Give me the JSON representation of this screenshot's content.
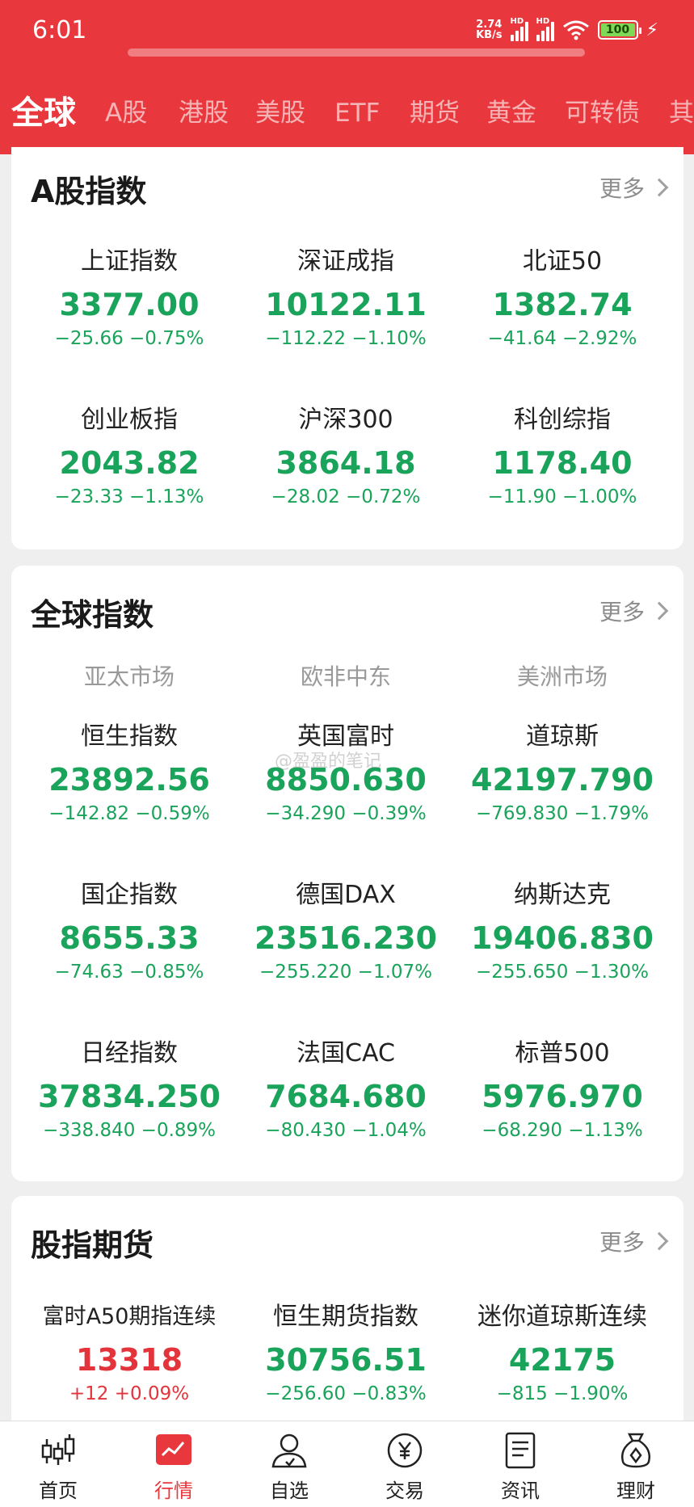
{
  "status_bar": {
    "time": "6:01",
    "net_speed_value": "2.74",
    "net_speed_unit": "KB/s",
    "hd_label_1": "HD",
    "hd_label_2": "HD",
    "battery": "100"
  },
  "tabs": [
    {
      "label": "全球",
      "active": true
    },
    {
      "label": "A股"
    },
    {
      "label": "港股"
    },
    {
      "label": "美股"
    },
    {
      "label": "ETF"
    },
    {
      "label": "期货"
    },
    {
      "label": "黄金"
    },
    {
      "label": "可转债"
    },
    {
      "label": "其"
    }
  ],
  "a_share": {
    "title": "A股指数",
    "more": "更多",
    "items": [
      {
        "name": "上证指数",
        "price": "3377.00",
        "change": "−25.66  −0.75%"
      },
      {
        "name": "深证成指",
        "price": "10122.11",
        "change": "−112.22  −1.10%"
      },
      {
        "name": "北证50",
        "price": "1382.74",
        "change": "−41.64  −2.92%"
      },
      {
        "name": "创业板指",
        "price": "2043.82",
        "change": "−23.33  −1.13%"
      },
      {
        "name": "沪深300",
        "price": "3864.18",
        "change": "−28.02  −0.72%"
      },
      {
        "name": "科创综指",
        "price": "1178.40",
        "change": "−11.90  −1.00%"
      }
    ]
  },
  "global": {
    "title": "全球指数",
    "more": "更多",
    "regions": [
      "亚太市场",
      "欧非中东",
      "美洲市场"
    ],
    "items": [
      {
        "name": "恒生指数",
        "price": "23892.56",
        "change": "−142.82  −0.59%"
      },
      {
        "name": "英国富时",
        "price": "8850.630",
        "change": "−34.290  −0.39%"
      },
      {
        "name": "道琼斯",
        "price": "42197.790",
        "change": "−769.830  −1.79%"
      },
      {
        "name": "国企指数",
        "price": "8655.33",
        "change": "−74.63  −0.85%"
      },
      {
        "name": "德国DAX",
        "price": "23516.230",
        "change": "−255.220  −1.07%"
      },
      {
        "name": "纳斯达克",
        "price": "19406.830",
        "change": "−255.650  −1.30%"
      },
      {
        "name": "日经指数",
        "price": "37834.250",
        "change": "−338.840  −0.89%"
      },
      {
        "name": "法国CAC",
        "price": "7684.680",
        "change": "−80.430  −1.04%"
      },
      {
        "name": "标普500",
        "price": "5976.970",
        "change": "−68.290  −1.13%"
      }
    ]
  },
  "futures": {
    "title": "股指期货",
    "more": "更多",
    "items": [
      {
        "name": "富时A50期指连续",
        "price": "13318",
        "change": "+12  +0.09%",
        "up": true
      },
      {
        "name": "恒生期货指数",
        "price": "30756.51",
        "change": "−256.60  −0.83%"
      },
      {
        "name": "迷你道琼斯连续",
        "price": "42175",
        "change": "−815  −1.90%"
      }
    ]
  },
  "watermark": "@盈盈的笔记",
  "nav": [
    {
      "label": "首页",
      "icon": "candlestick-icon"
    },
    {
      "label": "行情",
      "icon": "market-chart-icon",
      "active": true
    },
    {
      "label": "自选",
      "icon": "user-watchlist-icon"
    },
    {
      "label": "交易",
      "icon": "yuan-coin-icon"
    },
    {
      "label": "资讯",
      "icon": "news-doc-icon"
    },
    {
      "label": "理财",
      "icon": "money-bag-icon"
    }
  ],
  "colors": {
    "brand": "#e8383d",
    "down": "#1aa35a",
    "up": "#e3343c"
  }
}
